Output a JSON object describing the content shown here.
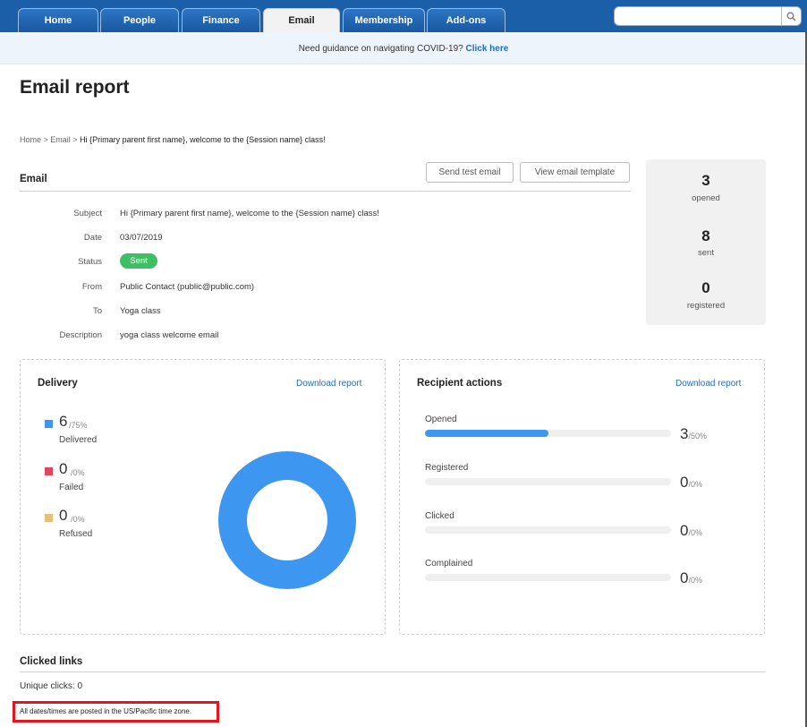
{
  "nav": {
    "tabs": [
      {
        "label": "Home"
      },
      {
        "label": "People"
      },
      {
        "label": "Finance"
      },
      {
        "label": "Email"
      },
      {
        "label": "Membership"
      },
      {
        "label": "Add-ons"
      }
    ],
    "active_tab": "Email",
    "search_value": ""
  },
  "banner": {
    "text": "Need guidance on navigating COVID-19?",
    "link": "Click here"
  },
  "page": {
    "title": "Email report",
    "breadcrumb": {
      "home": "Home",
      "sep1": " > ",
      "email": "Email",
      "sep2": " > ",
      "current": "Hi {Primary parent first name}, welcome to the {Session name} class!"
    }
  },
  "email": {
    "section_title": "Email",
    "send_test_label": "Send test email",
    "view_template_label": "View email template",
    "details": [
      {
        "label": "Subject",
        "value": "Hi {Primary parent first name}, welcome to the {Session name} class!"
      },
      {
        "label": "Date",
        "value": "03/07/2019"
      },
      {
        "label": "Status",
        "value": "Sent"
      },
      {
        "label": "From",
        "value": "Public Contact (public@public.com)"
      },
      {
        "label": "To",
        "value": "Yoga class"
      },
      {
        "label": "Description",
        "value": "yoga class welcome email"
      }
    ]
  },
  "stats": [
    {
      "value": "3",
      "label": "opened"
    },
    {
      "value": "8",
      "label": "sent"
    },
    {
      "value": "0",
      "label": "registered"
    }
  ],
  "delivery": {
    "title": "Delivery",
    "download_label": "Download report",
    "items": [
      {
        "value": "6",
        "pct": "/75%",
        "label": "Delivered",
        "color": "#3d96ef"
      },
      {
        "value": "0",
        "pct": "/0%",
        "label": "Failed",
        "color": "#e0475e"
      },
      {
        "value": "0",
        "pct": "/0%",
        "label": "Refused",
        "color": "#e4c07a"
      }
    ],
    "donut_fraction": 1.0,
    "donut_color": "#3d96ef"
  },
  "recipient_actions": {
    "title": "Recipient actions",
    "download_label": "Download report",
    "items": [
      {
        "label": "Opened",
        "value": "3",
        "pct": "/50%",
        "fraction": 0.5
      },
      {
        "label": "Registered",
        "value": "0",
        "pct": "/0%",
        "fraction": 0
      },
      {
        "label": "Clicked",
        "value": "0",
        "pct": "/0%",
        "fraction": 0
      },
      {
        "label": "Complained",
        "value": "0",
        "pct": "/0%",
        "fraction": 0
      }
    ]
  },
  "clicked_links": {
    "title": "Clicked links",
    "unique_clicks": "Unique clicks: 0",
    "timezone_note": "All dates/times are posted in the US/Pacific time zone."
  }
}
